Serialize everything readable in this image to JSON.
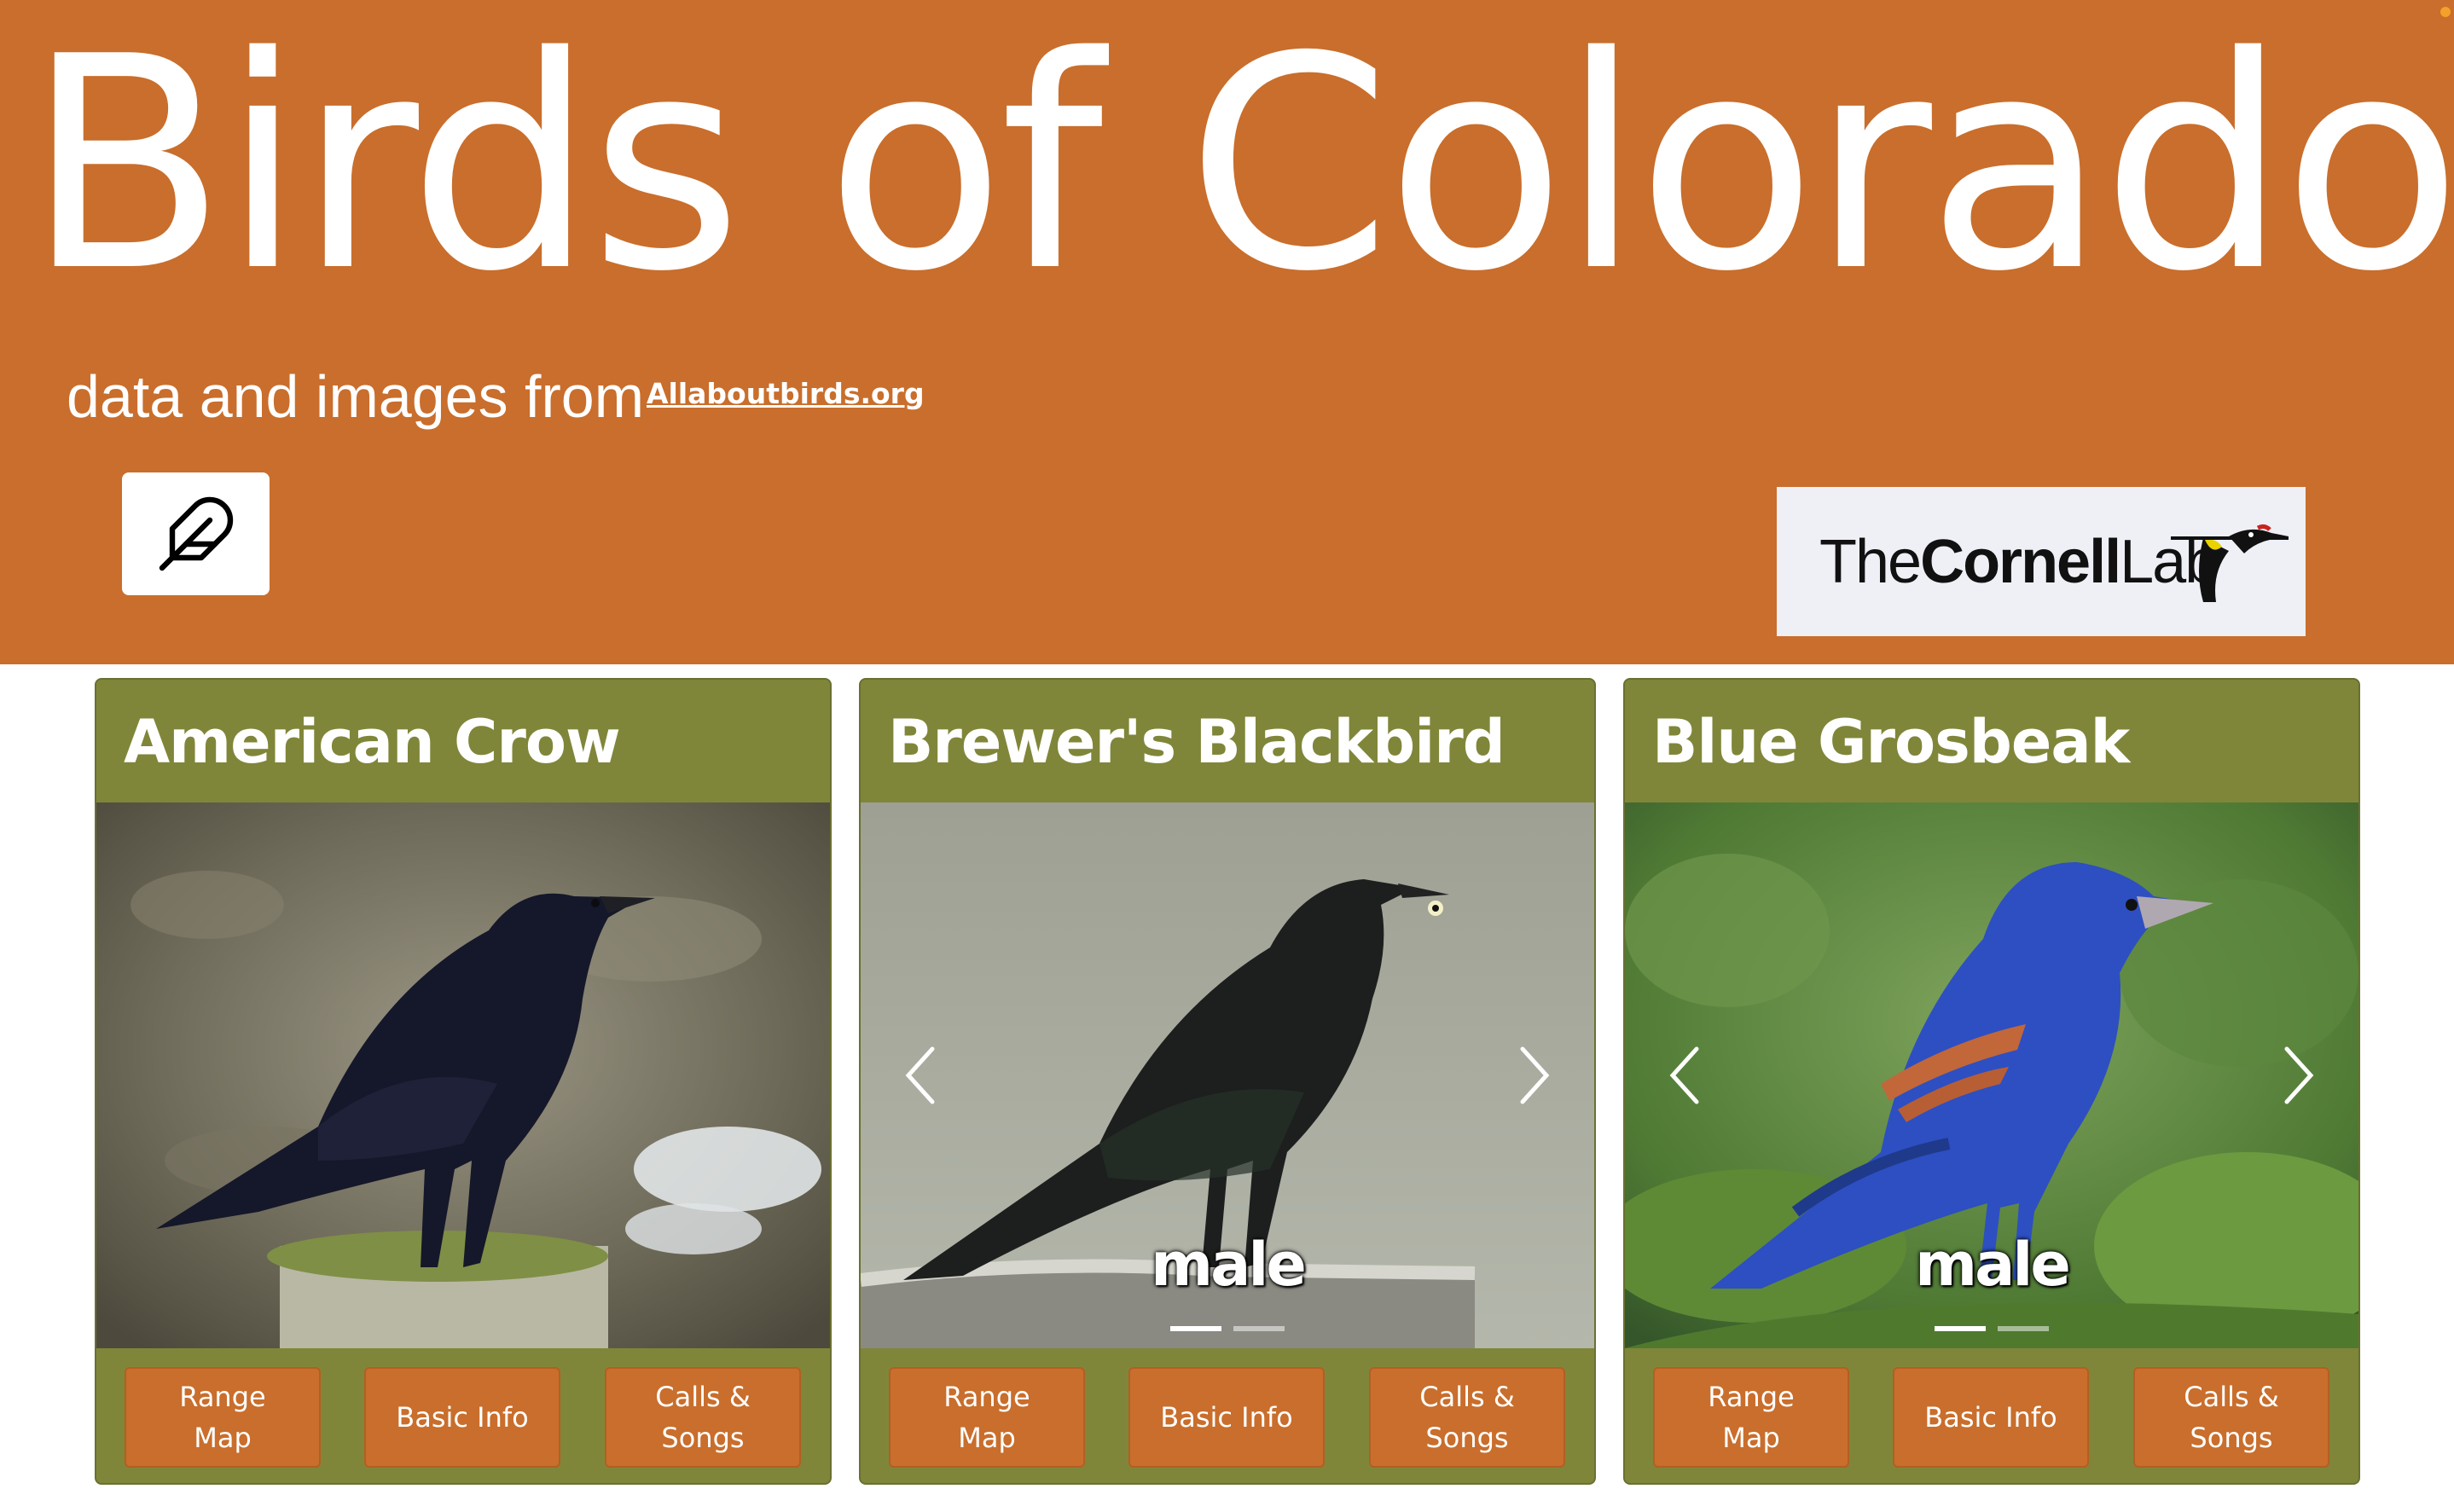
{
  "header": {
    "title": "Birds of Colorado",
    "subtitle": "data and images from",
    "source_link": "Allaboutbirds.org",
    "feather_icon": "feather-icon",
    "logo": {
      "part1": "The",
      "part2": "Cornell",
      "part3": "Lab"
    },
    "background_color": "#c96e2c"
  },
  "cards": [
    {
      "title": "American Crow",
      "caption": "",
      "has_carousel_controls": false,
      "buttons": {
        "range_map": "Range Map",
        "basic_info": "Basic Info",
        "calls_songs": "Calls & Songs"
      }
    },
    {
      "title": "Brewer's Blackbird",
      "caption": "male",
      "has_carousel_controls": true,
      "buttons": {
        "range_map": "Range Map",
        "basic_info": "Basic Info",
        "calls_songs": "Calls & Songs"
      }
    },
    {
      "title": "Blue Grosbeak",
      "caption": "male",
      "has_carousel_controls": true,
      "buttons": {
        "range_map": "Range Map",
        "basic_info": "Basic Info",
        "calls_songs": "Calls & Songs"
      }
    }
  ],
  "colors": {
    "accent": "#c96e2c",
    "card": "#808639"
  }
}
